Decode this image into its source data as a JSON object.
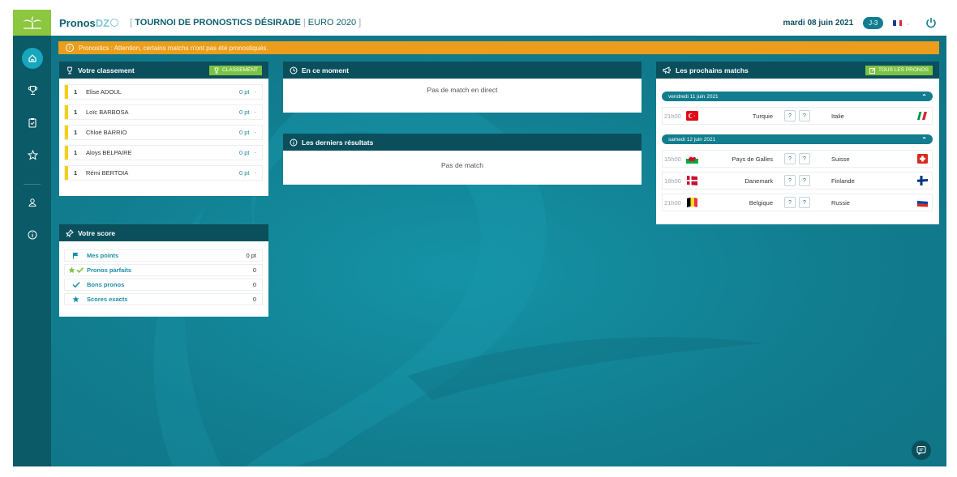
{
  "header": {
    "brand_main": "Pronos",
    "brand_accent": "DZ",
    "tournament_open": "[",
    "tournament_name": "TOURNOI DE PRONOSTICS DÉSIRADE",
    "tournament_sep": "|",
    "tournament_event": "EURO 2020",
    "tournament_close": "]",
    "date": "mardi 08 juin 2021",
    "countdown": "J-3"
  },
  "alert": {
    "text": "Pronostics : Attention, certains matchs n'ont pas été pronostiqués."
  },
  "ranking": {
    "title": "Votre classement",
    "button": "CLASSEMENT",
    "rows": [
      {
        "pos": "1",
        "name": "Elise ADOUL",
        "pts": "0 pt",
        "trend": "-"
      },
      {
        "pos": "1",
        "name": "Loïc BARBOSA",
        "pts": "0 pt",
        "trend": "-"
      },
      {
        "pos": "1",
        "name": "Chloé BARRIO",
        "pts": "0 pt",
        "trend": "-"
      },
      {
        "pos": "1",
        "name": "Aloys BELPAIRE",
        "pts": "0 pt",
        "trend": "-"
      },
      {
        "pos": "1",
        "name": "Rémi BERTOIA",
        "pts": "0 pt",
        "trend": "-"
      }
    ]
  },
  "score": {
    "title": "Votre score",
    "rows": [
      {
        "label": "Mes points",
        "value": "0 pt"
      },
      {
        "label": "Pronos parfaits",
        "value": "0"
      },
      {
        "label": "Bons pronos",
        "value": "0"
      },
      {
        "label": "Scores exacts",
        "value": "0"
      }
    ]
  },
  "live": {
    "title": "En ce moment",
    "empty": "Pas de match en direct"
  },
  "results": {
    "title": "Les derniers résultats",
    "empty": "Pas de match"
  },
  "upcoming": {
    "title": "Les prochains matchs",
    "button": "TOUS LES PRONOS",
    "days": [
      {
        "label": "vendredi 11 juin 2021",
        "matches": [
          {
            "time": "21h00",
            "home": "Turquie",
            "away": "Italie",
            "score_home": "?",
            "score_away": "?"
          }
        ]
      },
      {
        "label": "samedi 12 juin 2021",
        "matches": [
          {
            "time": "15h00",
            "home": "Pays de Galles",
            "away": "Suisse",
            "score_home": "?",
            "score_away": "?"
          },
          {
            "time": "18h00",
            "home": "Danemark",
            "away": "Finlande",
            "score_home": "?",
            "score_away": "?"
          },
          {
            "time": "21h00",
            "home": "Belgique",
            "away": "Russie",
            "score_home": "?",
            "score_away": "?"
          }
        ]
      }
    ]
  },
  "colors": {
    "primary": "#117d8f",
    "dark": "#0b4f5c",
    "sidebar": "#0b5a68",
    "accent_green": "#7cc242",
    "alert": "#eb9d1b",
    "rank_bar": "#f6d100"
  },
  "icons": {
    "sidebar": [
      "home-icon",
      "trophy-icon",
      "clipboard-icon",
      "star-icon",
      "user-icon",
      "info-icon"
    ]
  }
}
